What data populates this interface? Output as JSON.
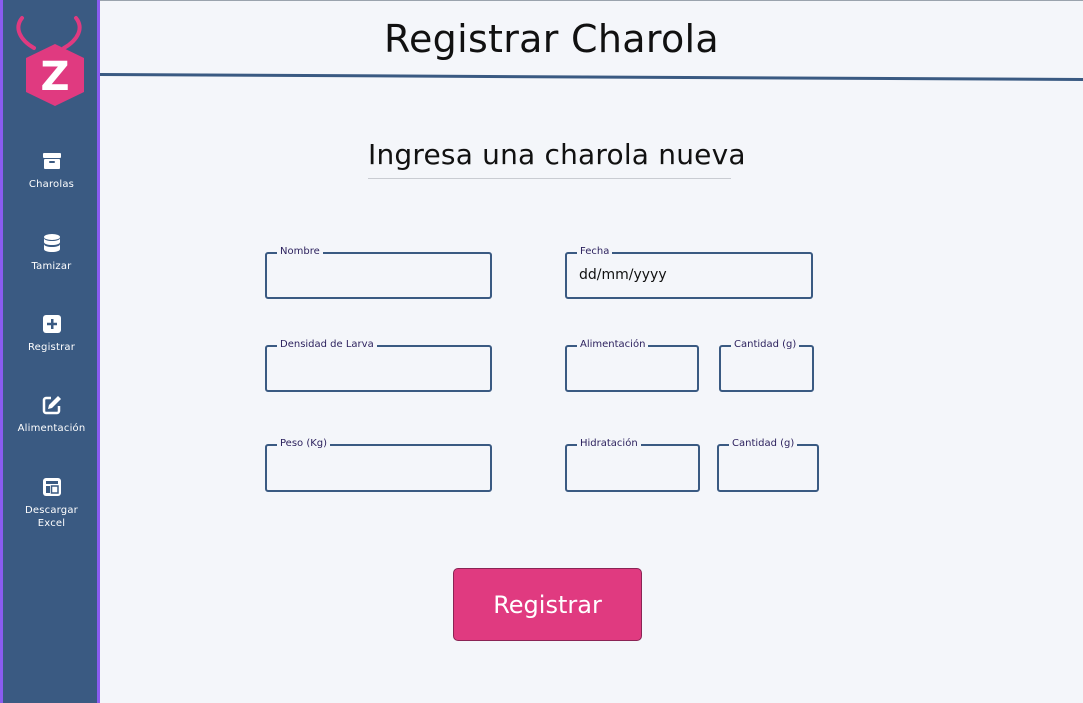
{
  "header": {
    "title": "Registrar Charola"
  },
  "form": {
    "subtitle": "Ingresa una charola nueva",
    "fields": {
      "nombre": {
        "label": "Nombre",
        "value": ""
      },
      "fecha": {
        "label": "Fecha",
        "value": "dd/mm/yyyy"
      },
      "densidad": {
        "label": "Densidad de Larva",
        "value": ""
      },
      "alimentacion": {
        "label": "Alimentación",
        "value": ""
      },
      "cantidad_alimento": {
        "label": "Cantidad (g)",
        "value": ""
      },
      "peso": {
        "label": "Peso (Kg)",
        "value": ""
      },
      "hidratacion": {
        "label": "Hidratación",
        "value": ""
      },
      "cantidad_hidratacion": {
        "label": "Cantidad (g)",
        "value": ""
      }
    },
    "submit_label": "Registrar"
  },
  "sidebar": {
    "logo_letter": "Z",
    "items": [
      {
        "label": "Charolas",
        "icon": "archive-box-icon"
      },
      {
        "label": "Tamizar",
        "icon": "database-icon"
      },
      {
        "label": "Registrar",
        "icon": "plus-square-icon"
      },
      {
        "label": "Alimentación",
        "icon": "edit-icon"
      },
      {
        "label": "Descargar Excel",
        "icon": "table-icon"
      }
    ]
  },
  "colors": {
    "sidebar": "#3a5a82",
    "sidebar_border": "#8a5cf0",
    "accent": "#e03a80",
    "field_border": "#3a5a82",
    "background": "#f4f6fa"
  }
}
